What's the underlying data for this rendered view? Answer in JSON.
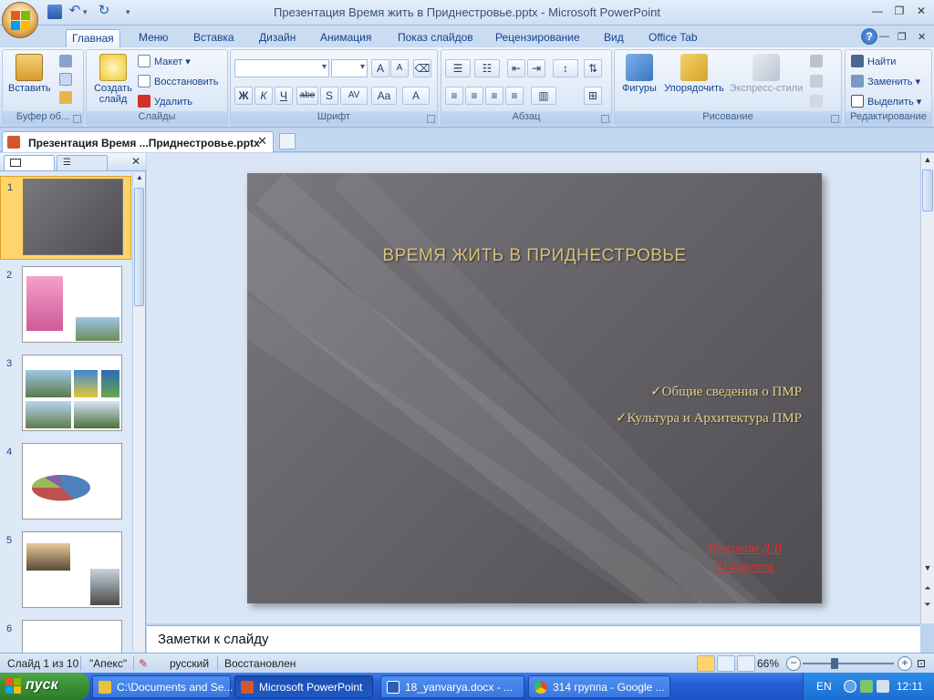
{
  "window": {
    "title": "Презентация  Время жить в Приднестровье.pptx - Microsoft PowerPoint",
    "controls": {
      "minimize": "—",
      "restore": "❐",
      "close": "✕"
    }
  },
  "ribbon": {
    "tabs": [
      "Главная",
      "Меню",
      "Вставка",
      "Дизайн",
      "Анимация",
      "Показ слайдов",
      "Рецензирование",
      "Вид",
      "Office Tab"
    ],
    "active_tab": "Главная",
    "groups": {
      "clipboard": {
        "label": "Буфер об...",
        "paste": "Вставить"
      },
      "slides": {
        "label": "Слайды",
        "new_slide": "Создать слайд",
        "layout": "Макет",
        "reset": "Восстановить",
        "delete": "Удалить"
      },
      "font": {
        "label": "Шрифт",
        "bold": "Ж",
        "italic": "К",
        "underline": "Ч",
        "strike": "abe",
        "shadow": "S",
        "spacing": "AV",
        "case": "Aa",
        "color": "A",
        "grow": "A",
        "shrink": "A"
      },
      "paragraph": {
        "label": "Абзац"
      },
      "drawing": {
        "label": "Рисование",
        "shapes": "Фигуры",
        "arrange": "Упорядочить",
        "quick_styles": "Экспресс-стили"
      },
      "editing": {
        "label": "Редактирование",
        "find": "Найти",
        "replace": "Заменить",
        "select": "Выделить"
      }
    }
  },
  "document_tab": {
    "label": "Презентация  Время ...Приднестровье.pptx",
    "close": "✕"
  },
  "thumbnails": {
    "items": [
      {
        "num": "1",
        "selected": true
      },
      {
        "num": "2",
        "selected": false
      },
      {
        "num": "3",
        "selected": false
      },
      {
        "num": "4",
        "selected": false
      },
      {
        "num": "5",
        "selected": false
      },
      {
        "num": "6",
        "selected": false
      }
    ]
  },
  "slide": {
    "title": "ВРЕМЯ ЖИТЬ В ПРИДНЕСТРОВЬЕ",
    "bullets": [
      "✓Общие сведения о ПМР",
      "✓Культура и Архитектура ПМР"
    ],
    "author_line1": "Трошкин Д.В",
    "author_line2": "314группа"
  },
  "notes": {
    "placeholder": "Заметки к слайду"
  },
  "statusbar": {
    "slide_info": "Слайд 1 из 10",
    "theme": "\"Апекс\"",
    "language": "русский",
    "state": "Восстановлен",
    "zoom": "66%",
    "zoom_level": 0.66
  },
  "taskbar": {
    "start": "пуск",
    "tasks": [
      {
        "label": "C:\\Documents and Se...",
        "active": false,
        "color": "#e9c13a"
      },
      {
        "label": "Microsoft PowerPoint",
        "active": true,
        "color": "#d4572b"
      },
      {
        "label": "18_yanvarya.docx - ...",
        "active": false,
        "color": "#2b5fb4"
      },
      {
        "label": "314 группа - Google ...",
        "active": false,
        "color": "#e04a3a"
      }
    ],
    "lang": "EN",
    "clock": "12:11"
  },
  "colors": {
    "accent": "#15428b",
    "slide_title": "#d9c07a",
    "bullet_text": "#e4cf86",
    "author_text": "#e0302a",
    "selection": "#ffd56b"
  }
}
